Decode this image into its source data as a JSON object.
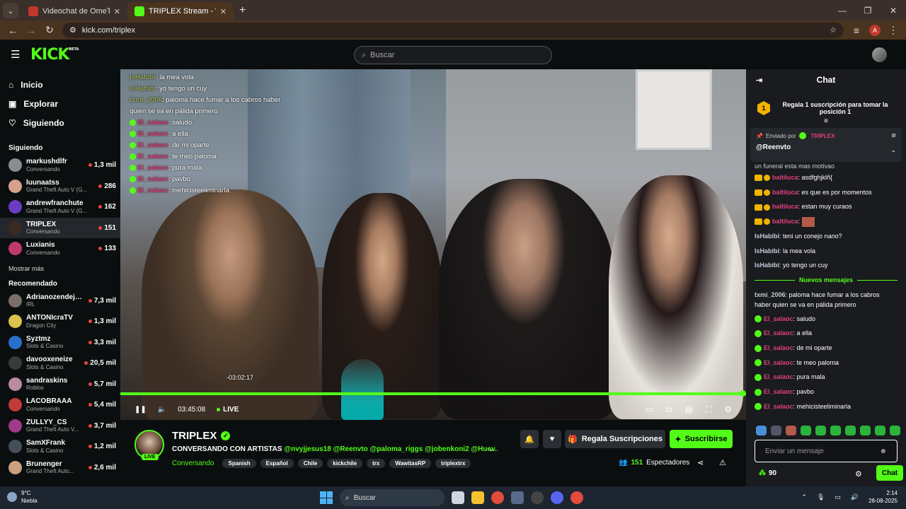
{
  "browser": {
    "tabs": [
      {
        "title": "Videochat de OmeTV: uno a"
      },
      {
        "title": "TRIPLEX Stream - Watch Li"
      }
    ],
    "url": "kick.com/triplex",
    "profile_initial": "A"
  },
  "header": {
    "logo": "KICK",
    "beta": "BETA",
    "search_placeholder": "Buscar"
  },
  "sidebar": {
    "nav": [
      {
        "label": "Inicio",
        "icon": "home-icon"
      },
      {
        "label": "Explorar",
        "icon": "compass-icon"
      },
      {
        "label": "Siguiendo",
        "icon": "heart-icon"
      }
    ],
    "following_title": "Siguiendo",
    "following": [
      {
        "name": "markushdlfr",
        "cat": "Conversando",
        "viewers": "1,3 mil",
        "color": "#8a8d90"
      },
      {
        "name": "luunaatss",
        "cat": "Grand Theft Auto V (G...",
        "viewers": "286",
        "color": "#d6a08c"
      },
      {
        "name": "andrewfranchute",
        "cat": "Grand Theft Auto V (G...",
        "viewers": "162",
        "color": "#6a3cc0"
      },
      {
        "name": "TRIPLEX",
        "cat": "Conversando",
        "viewers": "151",
        "color": "#3b2a22"
      },
      {
        "name": "Luxianis",
        "cat": "Conversando",
        "viewers": "133",
        "color": "#c0396b"
      }
    ],
    "show_more": "Mostrar más",
    "recommended_title": "Recomendado",
    "recommended": [
      {
        "name": "Adrianozendeja...",
        "cat": "IRL",
        "viewers": "7,3 mil",
        "color": "#7a6f66"
      },
      {
        "name": "ANTONIcraTV",
        "cat": "Dragon City",
        "viewers": "1,3 mil",
        "color": "#d9c34a"
      },
      {
        "name": "Syztmz",
        "cat": "Slots & Casino",
        "viewers": "3,3 mil",
        "color": "#2a6fc9"
      },
      {
        "name": "davooxeneize",
        "cat": "Slots & Casino",
        "viewers": "20,5 mil",
        "color": "#3a3a3a"
      },
      {
        "name": "sandraskins",
        "cat": "Roblox",
        "viewers": "5,7 mil",
        "color": "#b98aa0"
      },
      {
        "name": "LACOBRAAA",
        "cat": "Conversando",
        "viewers": "5,4 mil",
        "color": "#c23a3a"
      },
      {
        "name": "ZULLYY_CS",
        "cat": "Grand Theft Auto V...",
        "viewers": "3,7 mil",
        "color": "#a03a8a"
      },
      {
        "name": "SamXFrank",
        "cat": "Slots & Casino",
        "viewers": "1,2 mil",
        "color": "#444f5a"
      },
      {
        "name": "Brunenger",
        "cat": "Grand Theft Auto...",
        "viewers": "2,6 mil",
        "color": "#c9a080"
      }
    ]
  },
  "video": {
    "overlay_chat": [
      {
        "user": "IsHabibi",
        "sep": ": ",
        "text": "la mea vola",
        "style": "u"
      },
      {
        "user": "IsHabibi",
        "sep": ": ",
        "text": "yo tengo un cuy",
        "style": "u"
      },
      {
        "user": "txmi_2006",
        "sep": ": ",
        "text": "paloma hace fumar a los cabros haber",
        "style": "u"
      },
      {
        "user": "",
        "sep": "",
        "text": "quien se va en pálida primero",
        "style": "u"
      },
      {
        "user": "El_salaoc",
        "sep": ": ",
        "text": "saludo",
        "style": "r"
      },
      {
        "user": "El_salaoc",
        "sep": ": ",
        "text": "a ella",
        "style": "r"
      },
      {
        "user": "El_salaoc",
        "sep": ": ",
        "text": "de mi oparte",
        "style": "r"
      },
      {
        "user": "El_salaoc",
        "sep": ": ",
        "text": "te meo paloma",
        "style": "r"
      },
      {
        "user": "El_salaoc",
        "sep": ": ",
        "text": "pura mala",
        "style": "r"
      },
      {
        "user": "El_salaoc",
        "sep": ": ",
        "text": "pavbo",
        "style": "r"
      },
      {
        "user": "El_salaoc",
        "sep": ": ",
        "text": "mehicisteeliminarla",
        "style": "r"
      }
    ],
    "hover_time": "-03:02:17",
    "elapsed": "03:45:08",
    "live_label": "LIVE",
    "progress": 1.0
  },
  "channel": {
    "name": "TRIPLEX",
    "live_badge": "LIVE",
    "title_prefix": "CONVERSANDO CON ARTISTAS ",
    "mentions": "@nvyjjesus18 @Reenvto @paloma_riggs @jobenkoni2 @Huev...",
    "category": "Conversando",
    "tags": [
      "Spanish",
      "Español",
      "Chile",
      "kickchile",
      "trx",
      "WawitasRP",
      "triplextrx"
    ],
    "gift_label": "Regala Suscripciones",
    "subscribe_label": "Suscribirse",
    "viewers_count": "151",
    "viewers_label": "Espectadores"
  },
  "chat": {
    "title": "Chat",
    "top_gift_rank": "1",
    "top_gift_text": "Regala 1 suscripción para tomar la posición 1",
    "pinned_by_label": "Enviado por",
    "pinned_by_user": "TRIPLEX",
    "pinned_user": "@Reenvto",
    "cut_line": "un funeral esta mas motivao",
    "messages": [
      {
        "kind": "sub",
        "user": "baltiluca",
        "text": "asdfghjklñ{"
      },
      {
        "kind": "sub",
        "user": "baltiluca",
        "text": "es que es por momentos"
      },
      {
        "kind": "sub",
        "user": "baltiluca",
        "text": "estan muy curaos"
      },
      {
        "kind": "subimg",
        "user": "baltiluca",
        "text": ""
      },
      {
        "kind": "plain",
        "user": "IsHabibi",
        "text": "teni un conejo nano?"
      },
      {
        "kind": "plain",
        "user": "IsHabibi",
        "text": "la mea vola"
      },
      {
        "kind": "plain",
        "user": "IsHabibi",
        "text": "yo tengo un cuy"
      }
    ],
    "new_messages_label": "Nuevos mensajes",
    "multi_msg": {
      "user": "txmi_2006",
      "text": "paloma hace fumar a los cabros haber quien se va en pálida primero"
    },
    "messages2": [
      {
        "user": "El_salaoc",
        "text": "saludo"
      },
      {
        "user": "El_salaoc",
        "text": "a ella"
      },
      {
        "user": "El_salaoc",
        "text": "de mi oparte"
      },
      {
        "user": "El_salaoc",
        "text": "te meo paloma"
      },
      {
        "user": "El_salaoc",
        "text": "pura mala"
      },
      {
        "user": "El_salaoc",
        "text": "pavbo"
      },
      {
        "user": "El_salaoc",
        "text": "mehicisteeliminarla"
      }
    ],
    "input_placeholder": "Enviar un mensaje",
    "points": "90",
    "send_label": "Chat"
  },
  "taskbar": {
    "temp": "9°C",
    "weather": "Niebla",
    "search_placeholder": "Buscar",
    "time": "2:14",
    "date": "28-08-2025"
  },
  "colors": {
    "accent": "#53fc18",
    "badge_red": "#e0407a",
    "chat_bg": "#191b1f"
  }
}
